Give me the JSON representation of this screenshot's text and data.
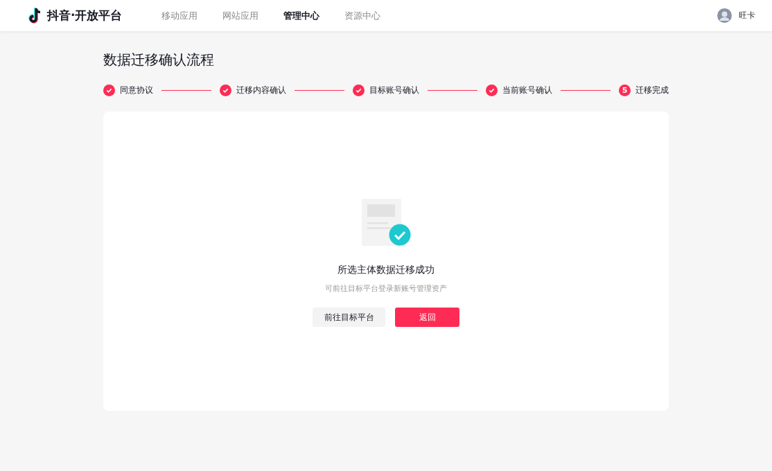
{
  "header": {
    "logo_text": "抖音·开放平台",
    "nav": [
      {
        "label": "移动应用",
        "selected": false
      },
      {
        "label": "网站应用",
        "selected": false
      },
      {
        "label": "管理中心",
        "selected": true
      },
      {
        "label": "资源中心",
        "selected": false
      }
    ],
    "user": {
      "name": "旺卡"
    }
  },
  "page_title": "数据迁移确认流程",
  "steps": [
    {
      "label": "同意协议",
      "kind": "done"
    },
    {
      "label": "迁移内容确认",
      "kind": "done"
    },
    {
      "label": "目标账号确认",
      "kind": "done"
    },
    {
      "label": "当前账号确认",
      "kind": "done"
    },
    {
      "label": "迁移完成",
      "kind": "current",
      "number": "5"
    }
  ],
  "result": {
    "title": "所选主体数据迁移成功",
    "subtitle": "可前往目标平台登录新账号管理资产",
    "buttons": [
      {
        "label": "前往目标平台",
        "kind": "secondary"
      },
      {
        "label": "返回",
        "kind": "primary"
      }
    ]
  }
}
